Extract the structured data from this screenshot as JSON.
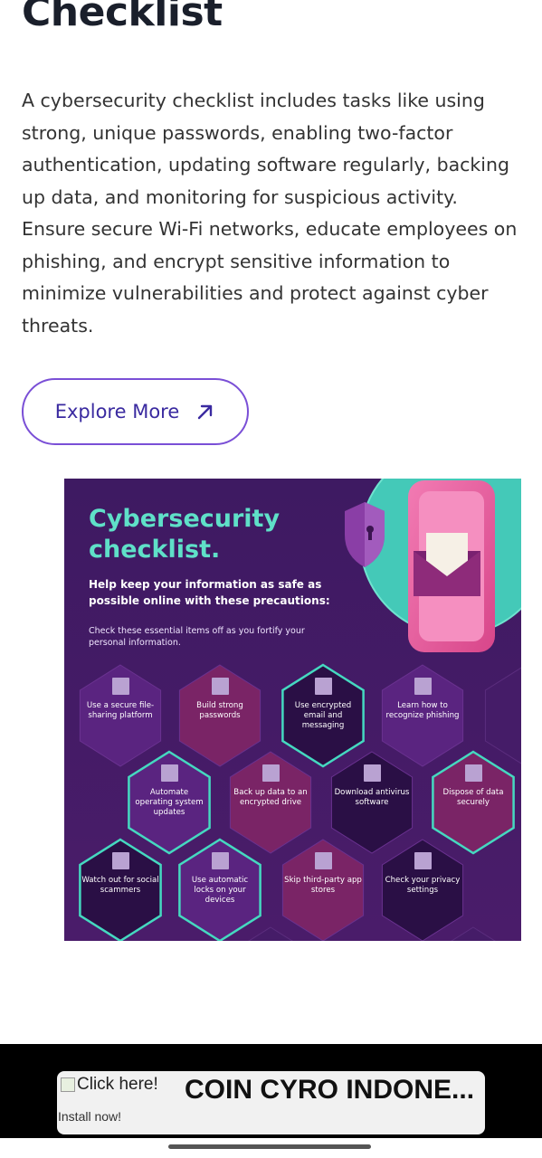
{
  "article": {
    "title": "Checklist",
    "intro": "A cybersecurity checklist includes tasks like using strong, unique passwords, enabling two-factor authentication, updating software regularly, backing up data, and monitoring for suspicious activity. Ensure secure Wi-Fi networks, educate employees on phishing, and encrypt sensitive information to minimize vulnerabilities and protect against cyber threats.",
    "explore_button": "Explore More",
    "explore_icon": "arrow-up-right-icon"
  },
  "infographic": {
    "title": "Cybersecurity checklist.",
    "subtitle": "Help keep your information as safe as possible online with these precautions:",
    "note": "Check these essential items off as you fortify your personal information.",
    "items": [
      "Use a secure file-sharing platform",
      "Build strong passwords",
      "Use encrypted email and messaging",
      "Learn how to recognize phishing",
      "Automate operating system updates",
      "Back up data to an encrypted drive",
      "Download antivirus software",
      "Dispose of data securely",
      "Watch out for social scammers",
      "Use automatic locks on your devices",
      "Skip third-party app stores",
      "Check your privacy settings"
    ],
    "colors": {
      "background": "#3d1a5e",
      "title": "#5fe0c8",
      "hex_dark": "#2a0f45",
      "hex_purple": "#5a2480",
      "hex_magenta": "#7a2466",
      "teal_accent": "#45d9c0",
      "phone_pink": "#e8599a"
    }
  },
  "ad": {
    "image_alt": "Click here!",
    "headline": "COIN CYRO INDONE...",
    "cta": "Install now!"
  }
}
